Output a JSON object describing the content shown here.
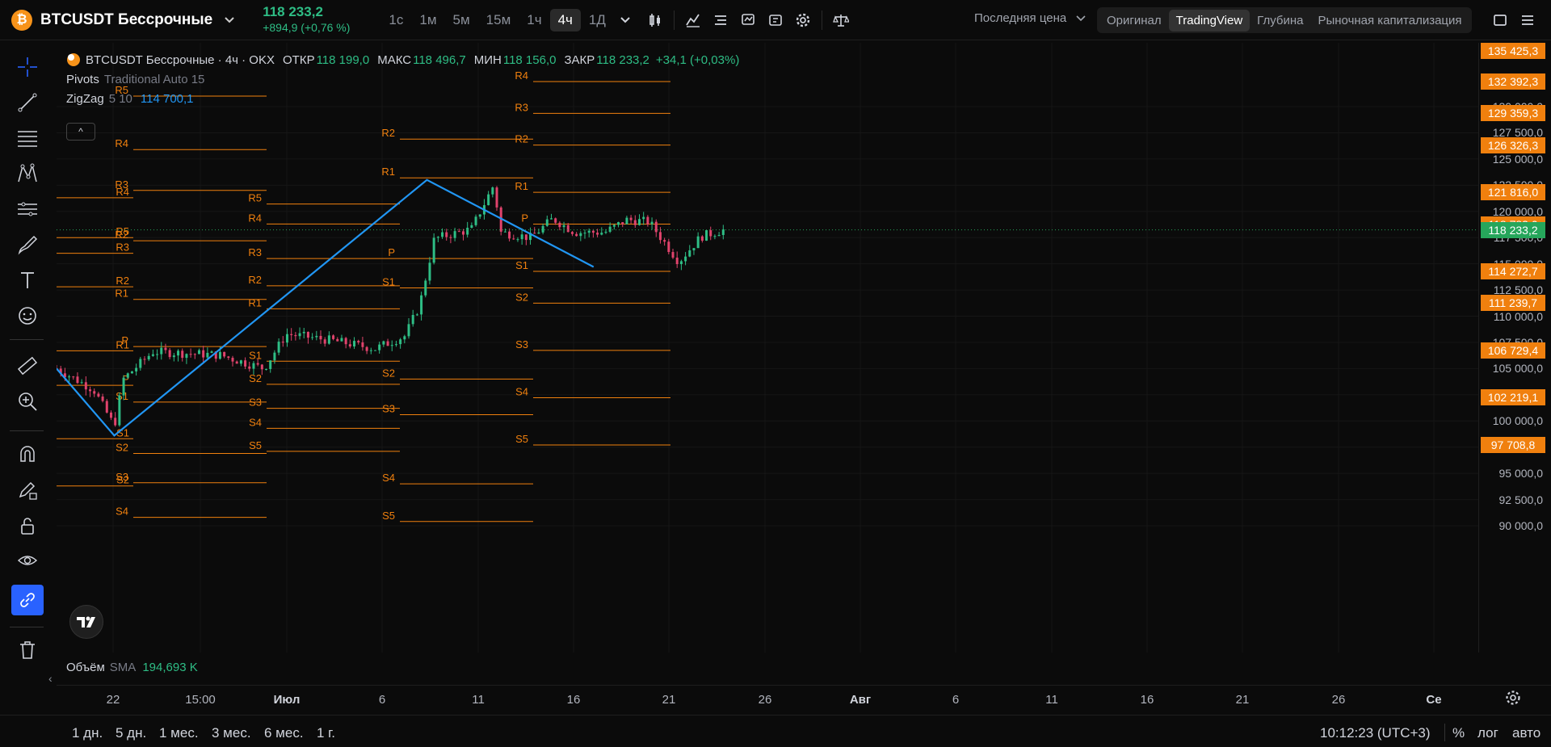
{
  "header": {
    "symbol": "BTCUSDT Бессрочные",
    "coin_glyph": "₿",
    "last_price": "118 233,2",
    "change": "+894,9 (+0,76 %)",
    "intervals": [
      "1с",
      "1м",
      "5м",
      "15м",
      "1ч",
      "4ч",
      "1Д"
    ],
    "active_interval": "4ч",
    "price_type": "Последняя цена",
    "view_tabs": [
      "Оригинал",
      "TradingView",
      "Глубина",
      "Рыночная капитализация"
    ],
    "active_view": "TradingView"
  },
  "legend": {
    "title": "BTCUSDT Бессрочные · 4ч · OKX",
    "open_label": "ОТКР",
    "open": "118 199,0",
    "high_label": "МАКС",
    "high": "118 496,7",
    "low_label": "МИН",
    "low": "118 156,0",
    "close_label": "ЗАКР",
    "close": "118 233,2",
    "change": "+34,1 (+0,03%)",
    "pivots_name": "Pivots",
    "pivots_params": "Traditional Auto 15",
    "zigzag_name": "ZigZag",
    "zigzag_params": "5 10",
    "zigzag_value": "114 700,1",
    "collapse_glyph": "^"
  },
  "volume": {
    "name": "Объём",
    "ma": "SMA",
    "value": "194,693 K"
  },
  "price_axis": {
    "ticks": [
      "130 000,0",
      "127 500,0",
      "125 000,0",
      "122 500,0",
      "120 000,0",
      "117 500,0",
      "115 000,0",
      "112 500,0",
      "110 000,0",
      "107 500,0",
      "105 000,0",
      "102 500,0",
      "100 000,0",
      "97 500,0",
      "95 000,0",
      "92 500,0",
      "90 000,0"
    ],
    "labels": [
      "135 425,3",
      "132 392,3",
      "129 359,3",
      "126 326,3",
      "121 816,0",
      "118 783,0",
      "114 272,7",
      "111 239,7",
      "106 729,4",
      "102 219,1",
      "97 708,8"
    ],
    "last_label": "118 233,2"
  },
  "time_axis": [
    {
      "label": "22",
      "bold": false
    },
    {
      "label": "15:00",
      "bold": false
    },
    {
      "label": "Июл",
      "bold": true
    },
    {
      "label": "6",
      "bold": false
    },
    {
      "label": "11",
      "bold": false
    },
    {
      "label": "16",
      "bold": false
    },
    {
      "label": "21",
      "bold": false
    },
    {
      "label": "26",
      "bold": false
    },
    {
      "label": "Авг",
      "bold": true
    },
    {
      "label": "6",
      "bold": false
    },
    {
      "label": "11",
      "bold": false
    },
    {
      "label": "16",
      "bold": false
    },
    {
      "label": "21",
      "bold": false
    },
    {
      "label": "26",
      "bold": false
    },
    {
      "label": "Се",
      "bold": true
    }
  ],
  "bottom": {
    "ranges": [
      "1 дн.",
      "5 дн.",
      "1 мес.",
      "3 мес.",
      "6 мес.",
      "1 г."
    ],
    "clock": "10:12:23 (UTC+3)",
    "percent": "%",
    "log": "лог",
    "auto": "авто"
  },
  "pivot_blocks": [
    {
      "levels": [
        [
          "R5",
          117500
        ],
        [
          "R4",
          121300
        ],
        [
          "R3",
          116000
        ],
        [
          "R2",
          112800
        ],
        [
          "R1",
          106700
        ],
        [
          "P",
          103400
        ],
        [
          "S1",
          98300
        ],
        [
          "S2",
          93800
        ]
      ]
    },
    {
      "levels": [
        [
          "R5",
          131000
        ],
        [
          "R4",
          125900
        ],
        [
          "R3",
          122000
        ],
        [
          "R2",
          117200
        ],
        [
          "R1",
          111600
        ],
        [
          "P",
          107100
        ],
        [
          "S1",
          101800
        ],
        [
          "S2",
          96900
        ],
        [
          "S3",
          94100
        ],
        [
          "S4",
          90800
        ]
      ]
    },
    {
      "levels": [
        [
          "R5",
          120700
        ],
        [
          "R4",
          118800
        ],
        [
          "R3",
          115500
        ],
        [
          "R2",
          112900
        ],
        [
          "R1",
          110700
        ],
        [
          "S1",
          105700
        ],
        [
          "S2",
          103500
        ],
        [
          "S3",
          101200
        ],
        [
          "S4",
          99300
        ],
        [
          "S5",
          97100
        ]
      ]
    },
    {
      "levels": [
        [
          "R2",
          126900
        ],
        [
          "R1",
          123200
        ],
        [
          "P",
          115500
        ],
        [
          "S1",
          112700
        ],
        [
          "S2",
          104000
        ],
        [
          "S3",
          100600
        ],
        [
          "S4",
          94000
        ],
        [
          "S5",
          90400
        ]
      ]
    },
    {
      "levels": [
        [
          "R4",
          132392.3
        ],
        [
          "R3",
          129359.3
        ],
        [
          "R2",
          126326.3
        ],
        [
          "R1",
          121816.0
        ],
        [
          "P",
          118783.0
        ],
        [
          "S1",
          114272.7
        ],
        [
          "S2",
          111239.7
        ],
        [
          "S3",
          106729.4
        ],
        [
          "S4",
          102219.1
        ],
        [
          "S5",
          97708.8
        ]
      ]
    }
  ],
  "zigzag_points": [
    [
      0,
      105000
    ],
    [
      0.078,
      98600
    ],
    [
      0.5,
      123000
    ],
    [
      0.725,
      114700
    ]
  ],
  "colors": {
    "up": "#2ebd85",
    "down": "#e0436c",
    "pivot": "#f0800e",
    "zigzag": "#2196f3",
    "last": "#26a65b"
  }
}
